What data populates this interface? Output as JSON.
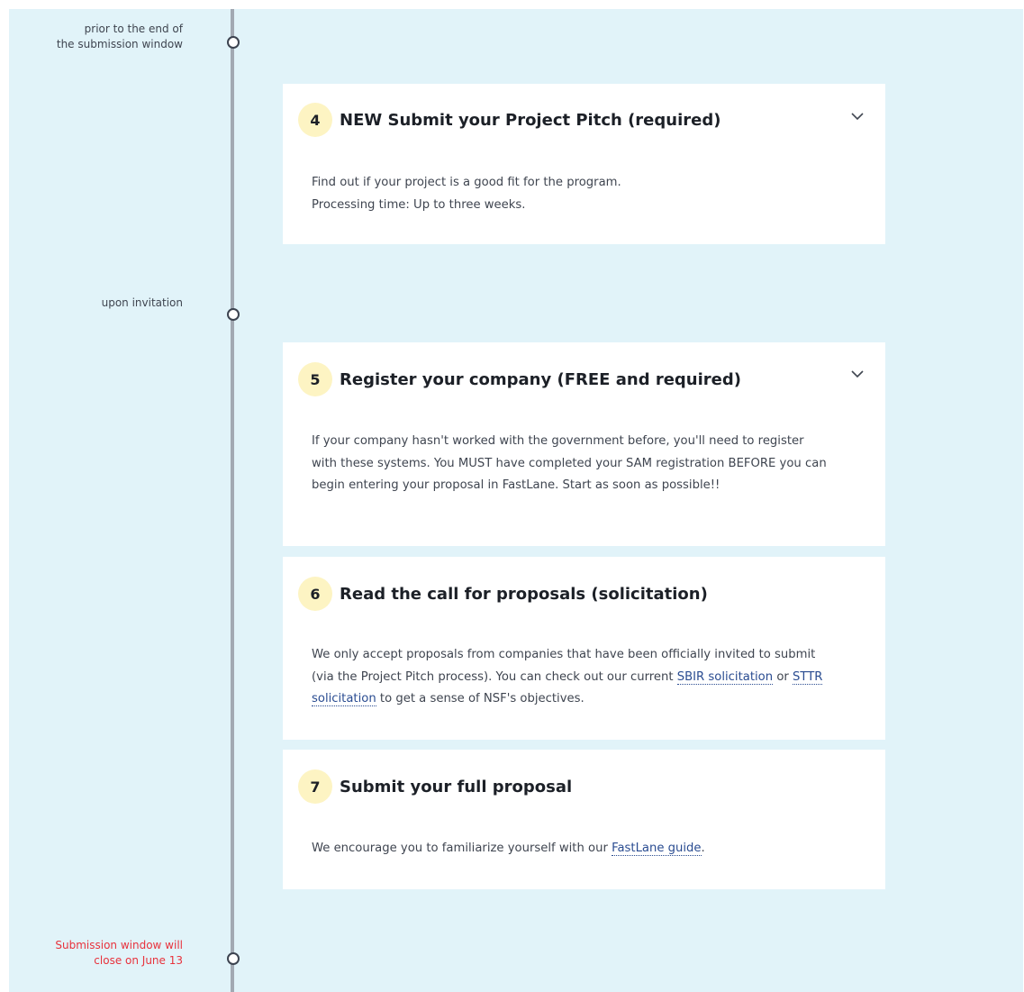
{
  "timeline": {
    "milestones": [
      {
        "line1": "prior to the end of",
        "line2": "the submission window"
      },
      {
        "line1": "upon invitation"
      },
      {
        "line1": "Submission window will",
        "line2": "close on June 13"
      }
    ]
  },
  "steps": [
    {
      "number": "4",
      "title": "NEW Submit your Project Pitch (required)",
      "line1": "Find out if your project is a good fit for the program.",
      "line2": "Processing time: Up to three weeks.",
      "expand_icon": "chevron-down-icon"
    },
    {
      "number": "5",
      "title": "Register your company (FREE and required)",
      "desc": "If your company hasn't worked with the government before, you'll need to register with these systems. You MUST have completed your SAM registration BEFORE you can begin entering your proposal in FastLane. Start as soon as possible!!",
      "expand_icon": "chevron-down-icon"
    },
    {
      "number": "6",
      "title": "Read the call for proposals (solicitation)",
      "desc_pre": "We only accept proposals from companies that have been officially invited to submit (via the Project Pitch process). You can check out our current",
      "link1": "SBIR solicitation",
      "desc_mid": "or",
      "link2": "STTR solicitation",
      "desc_post": "to get a sense of NSF's objectives."
    },
    {
      "number": "7",
      "title": "Submit your full proposal",
      "desc_pre": "We encourage you to familiarize yourself with our",
      "link1": "FastLane guide",
      "desc_post": "."
    }
  ],
  "colors": {
    "background": "#e1f3f9",
    "badge": "#fdf4c3",
    "alert": "#e8323c",
    "link": "#2a4c91"
  }
}
